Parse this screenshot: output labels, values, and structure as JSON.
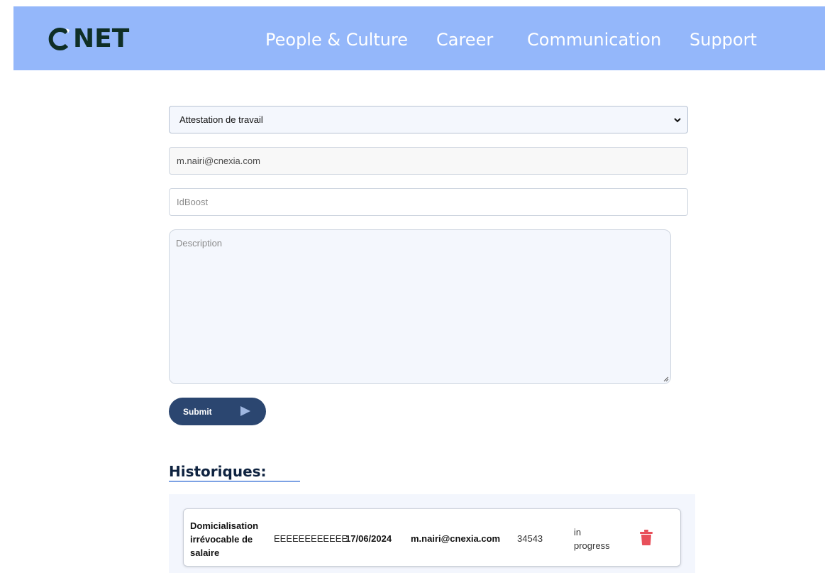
{
  "brand": {
    "logo_text": "NET",
    "logo_color": "#0f2f26"
  },
  "nav": {
    "background": "#94b7fa",
    "items": [
      {
        "label": "People & Culture"
      },
      {
        "label": "Career"
      },
      {
        "label": "Communication"
      },
      {
        "label": "Support"
      }
    ]
  },
  "form": {
    "request_type": {
      "selected": "Attestation de travail"
    },
    "email": {
      "value": "m.nairi@cnexia.com"
    },
    "id_boost": {
      "placeholder": "IdBoost"
    },
    "description": {
      "placeholder": "Description"
    },
    "submit_label": "Submit",
    "submit_color": "#2b4670"
  },
  "history": {
    "title": "Historiques:",
    "rows": [
      {
        "type": "Domicialisation irrévocable de salaire",
        "description": "EEEEEEEEEEEE",
        "date": "17/06/2024",
        "email": "m.nairi@cnexia.com",
        "id": "34543",
        "status": "in progress",
        "delete_icon": "trash-icon",
        "delete_color": "#e8505b"
      }
    ]
  }
}
